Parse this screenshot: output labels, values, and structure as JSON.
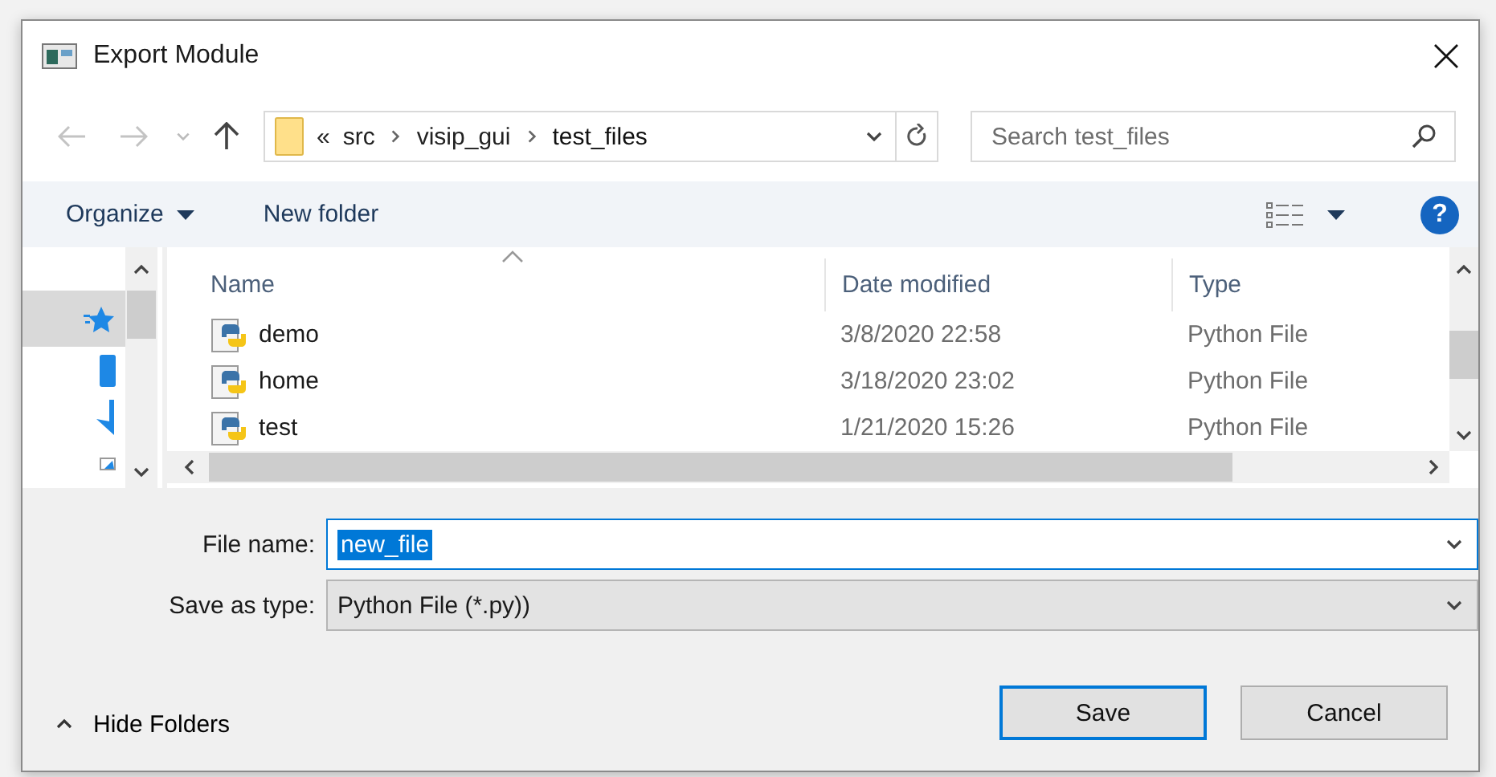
{
  "window": {
    "title": "Export Module"
  },
  "navigation": {
    "path": [
      "«",
      "src",
      "visip_gui",
      "test_files"
    ],
    "search": {
      "placeholder": "Search test_files"
    }
  },
  "toolbar": {
    "organize": "Organize",
    "new_folder": "New folder",
    "help": "?"
  },
  "nav_pane": {
    "items": [
      {
        "selected": true
      },
      {
        "selected": false
      },
      {
        "selected": false
      },
      {
        "selected": false
      }
    ]
  },
  "table": {
    "columns": [
      "Name",
      "Date modified",
      "Type"
    ],
    "rows": [
      {
        "name": "demo",
        "date": "3/8/2020 22:58",
        "type": "Python File"
      },
      {
        "name": "home",
        "date": "3/18/2020 23:02",
        "type": "Python File"
      },
      {
        "name": "test",
        "date": "1/21/2020 15:26",
        "type": "Python File"
      }
    ]
  },
  "form": {
    "file_name": {
      "label": "File name:",
      "value": "new_file",
      "text_selected": true
    },
    "save_as_type": {
      "label": "Save as type:",
      "value": "Python File (*.py))"
    }
  },
  "hide_folders": "Hide Folders",
  "buttons": [
    {
      "label": "Save",
      "default": true
    },
    {
      "label": "Cancel",
      "default": false
    }
  ]
}
